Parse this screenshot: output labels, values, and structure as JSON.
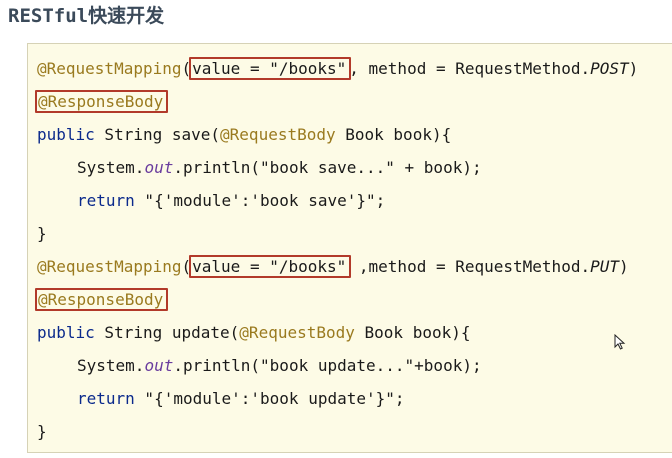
{
  "page": {
    "title_mono": "RESTful",
    "title_cjk": "快速开发"
  },
  "code": {
    "l1_ann": "@RequestMapping",
    "l1_paren": "(",
    "l1_boxed": "value = \"/books\"",
    "l1_rest": ", method = RequestMethod.",
    "l1_method": "POST",
    "l1_close": ")",
    "l2_ann": "@ResponseBody",
    "l3_kw": "public",
    "l3_mid": " String save(",
    "l3_ann": "@RequestBody",
    "l3_end": " Book book){",
    "l4_pre": "System.",
    "l4_out": "out",
    "l4_end": ".println(\"book save...\" + book);",
    "l5_kw": "return",
    "l5_end": " \"{'module':'book save'}\";",
    "l6": "}",
    "l7_ann": "@RequestMapping",
    "l7_paren": "(",
    "l7_boxed": "value = \"/books\"",
    "l7_rest": " ,method = RequestMethod.",
    "l7_method": "PUT",
    "l7_close": ")",
    "l8_ann": "@ResponseBody",
    "l9_kw": "public",
    "l9_mid": " String update(",
    "l9_ann": "@RequestBody",
    "l9_end": " Book book){",
    "l10_pre": "System.",
    "l10_out": "out",
    "l10_end": ".println(\"book update...\"+book);",
    "l11_kw": "return",
    "l11_end": " \"{'module':'book update'}\";",
    "l12": "}"
  },
  "colors": {
    "annotation": "#9a7a1f",
    "keyword": "#0b2a8c",
    "highlight_border": "#b23a2a",
    "panel_background": "#fdfbe6"
  },
  "icons": {
    "cursor": "mouse-pointer-icon"
  }
}
